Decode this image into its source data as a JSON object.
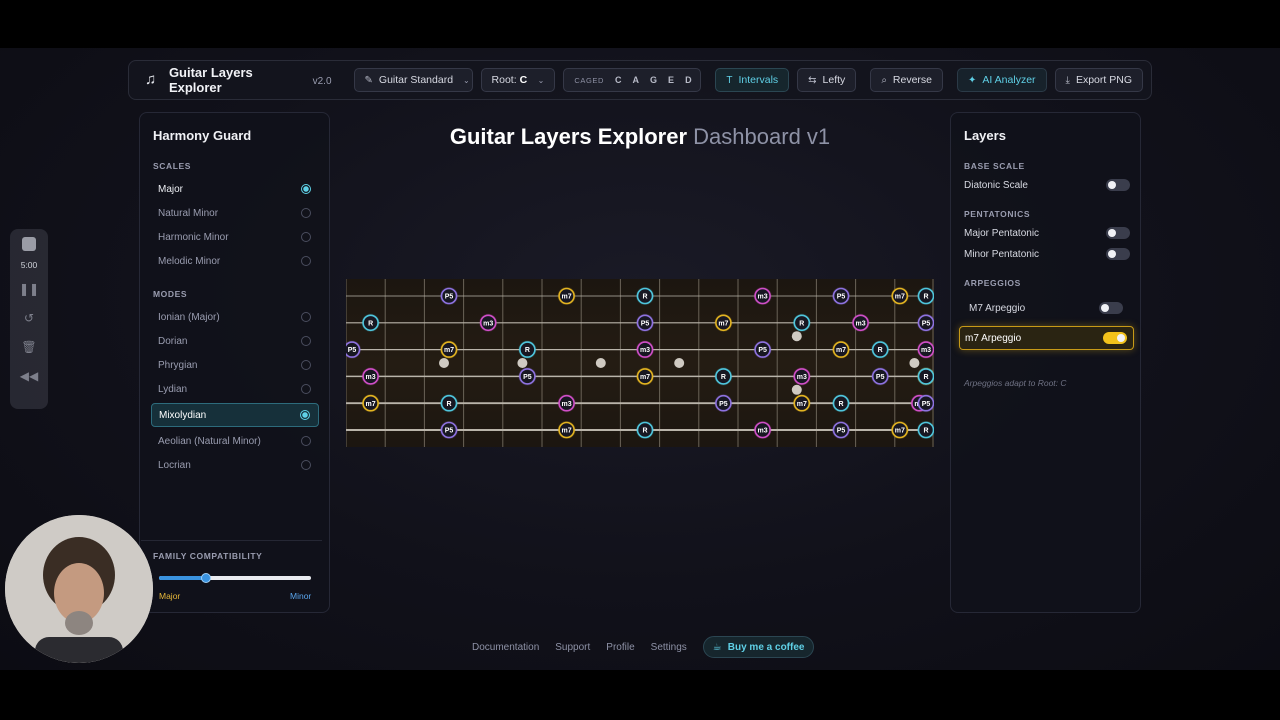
{
  "toolbar": {
    "app_title": "Guitar Layers Explorer",
    "version": "v2.0",
    "instrument": "Guitar Standard",
    "root_label": "Root:",
    "root_value": "C",
    "caged_label": "CAGED",
    "caged_shapes": [
      "C",
      "A",
      "G",
      "E",
      "D"
    ],
    "intervals_label": "Intervals",
    "lefty_label": "Lefty",
    "reverse_label": "Reverse",
    "ai_label": "AI Analyzer",
    "export_label": "Export PNG"
  },
  "left_panel": {
    "title": "Harmony Guard",
    "scales_label": "SCALES",
    "scales": [
      {
        "label": "Major",
        "selected": true
      },
      {
        "label": "Natural Minor",
        "selected": false
      },
      {
        "label": "Harmonic Minor",
        "selected": false
      },
      {
        "label": "Melodic Minor",
        "selected": false
      }
    ],
    "modes_label": "MODES",
    "modes": [
      {
        "label": "Ionian (Major)",
        "selected": false
      },
      {
        "label": "Dorian",
        "selected": false
      },
      {
        "label": "Phrygian",
        "selected": false
      },
      {
        "label": "Lydian",
        "selected": false
      },
      {
        "label": "Mixolydian",
        "selected": true
      },
      {
        "label": "Aeolian (Natural Minor)",
        "selected": false
      },
      {
        "label": "Locrian",
        "selected": false
      }
    ],
    "family_label": "FAMILY COMPATIBILITY",
    "family_value": 0.31,
    "family_min_label": "Major",
    "family_max_label": "Minor"
  },
  "main": {
    "title_bold": "Guitar Layers Explorer",
    "title_light": "Dashboard v1"
  },
  "fretboard": {
    "frets_shown": 15,
    "strings": 6,
    "inlays": [
      {
        "string_gap": 3,
        "fret": 3
      },
      {
        "string_gap": 3,
        "fret": 5
      },
      {
        "string_gap": 3,
        "fret": 7
      },
      {
        "string_gap": 3,
        "fret": 9
      },
      {
        "string_gap": 2,
        "fret": 12
      },
      {
        "string_gap": 4,
        "fret": 12
      },
      {
        "string_gap": 3,
        "fret": 15
      }
    ],
    "notes": [
      {
        "string": 1,
        "fret": 3,
        "label": "P5"
      },
      {
        "string": 1,
        "fret": 6,
        "label": "m7"
      },
      {
        "string": 1,
        "fret": 8,
        "label": "R"
      },
      {
        "string": 1,
        "fret": 11,
        "label": "m3"
      },
      {
        "string": 1,
        "fret": 13,
        "label": "P5"
      },
      {
        "string": 1,
        "fret": 14.5,
        "label": "m7"
      },
      {
        "string": 1,
        "fret": 15.2,
        "label": "R"
      },
      {
        "string": 2,
        "fret": 1,
        "label": "R"
      },
      {
        "string": 2,
        "fret": 4,
        "label": "m3"
      },
      {
        "string": 2,
        "fret": 8,
        "label": "P5"
      },
      {
        "string": 2,
        "fret": 10,
        "label": "m7"
      },
      {
        "string": 2,
        "fret": 12,
        "label": "R"
      },
      {
        "string": 2,
        "fret": 13.5,
        "label": "m3"
      },
      {
        "string": 2,
        "fret": 15.2,
        "label": "P5"
      },
      {
        "string": 3,
        "fret": 0,
        "label": "P5"
      },
      {
        "string": 3,
        "fret": 3,
        "label": "m7"
      },
      {
        "string": 3,
        "fret": 5,
        "label": "R"
      },
      {
        "string": 3,
        "fret": 8,
        "label": "m3"
      },
      {
        "string": 3,
        "fret": 11,
        "label": "P5"
      },
      {
        "string": 3,
        "fret": 13,
        "label": "m7"
      },
      {
        "string": 3,
        "fret": 14,
        "label": "R"
      },
      {
        "string": 3,
        "fret": 15.2,
        "label": "m3"
      },
      {
        "string": 4,
        "fret": 1,
        "label": "m3"
      },
      {
        "string": 4,
        "fret": 5,
        "label": "P5"
      },
      {
        "string": 4,
        "fret": 8,
        "label": "m7"
      },
      {
        "string": 4,
        "fret": 10,
        "label": "R"
      },
      {
        "string": 4,
        "fret": 12,
        "label": "m3"
      },
      {
        "string": 4,
        "fret": 14,
        "label": "P5"
      },
      {
        "string": 4,
        "fret": 15.2,
        "label": "m7"
      },
      {
        "string": 4,
        "fret": 16,
        "label": "R"
      },
      {
        "string": 5,
        "fret": 1,
        "label": "m7"
      },
      {
        "string": 5,
        "fret": 3,
        "label": "R"
      },
      {
        "string": 5,
        "fret": 6,
        "label": "m3"
      },
      {
        "string": 5,
        "fret": 10,
        "label": "P5"
      },
      {
        "string": 5,
        "fret": 12,
        "label": "m7"
      },
      {
        "string": 5,
        "fret": 13,
        "label": "R"
      },
      {
        "string": 5,
        "fret": 15,
        "label": "m3"
      },
      {
        "string": 5,
        "fret": 16,
        "label": "P5"
      },
      {
        "string": 6,
        "fret": 3,
        "label": "P5"
      },
      {
        "string": 6,
        "fret": 6,
        "label": "m7"
      },
      {
        "string": 6,
        "fret": 8,
        "label": "R"
      },
      {
        "string": 6,
        "fret": 11,
        "label": "m3"
      },
      {
        "string": 6,
        "fret": 13,
        "label": "P5"
      },
      {
        "string": 6,
        "fret": 14.5,
        "label": "m7"
      },
      {
        "string": 6,
        "fret": 15.2,
        "label": "R"
      }
    ],
    "colors": {
      "R": "#4fc6dd",
      "P5": "#8e72e0",
      "m3": "#d04fc8",
      "m7": "#e3b421"
    }
  },
  "right_panel": {
    "title": "Layers",
    "base_label": "BASE SCALE",
    "diatonic_label": "Diatonic Scale",
    "diatonic_on": false,
    "penta_label": "PENTATONICS",
    "major_penta_label": "Major Pentatonic",
    "minor_penta_label": "Minor Pentatonic",
    "arp_label": "ARPEGGIOS",
    "M7_label": "M7 Arpeggio",
    "m7_label": "m7 Arpeggio",
    "m7_on": true,
    "note": "Arpeggios adapt to Root: C"
  },
  "footer": {
    "links": [
      "Documentation",
      "Support",
      "Profile",
      "Settings"
    ],
    "coffee_label": "Buy me a coffee"
  },
  "recorder": {
    "time": "5:00"
  }
}
